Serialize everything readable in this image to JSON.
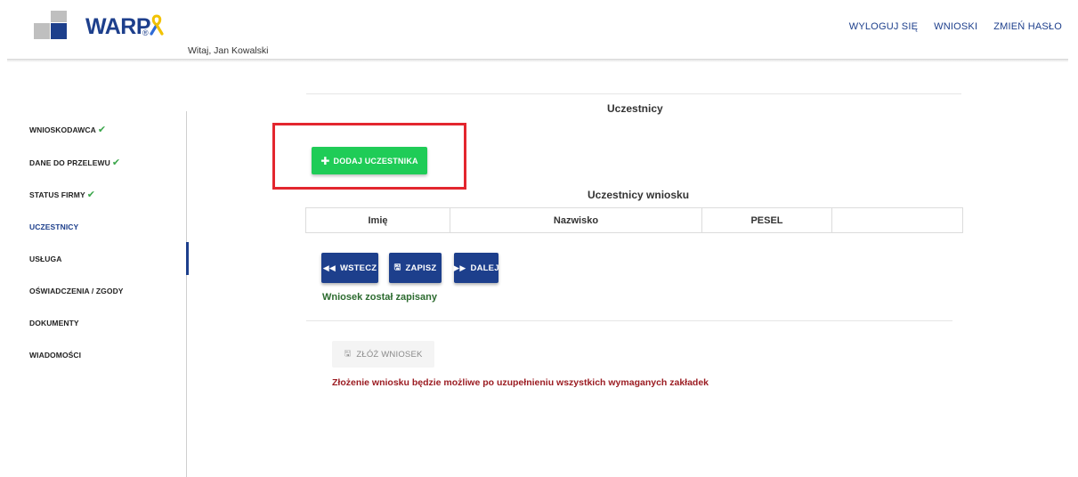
{
  "brand": {
    "name": "WARP",
    "reg": "®",
    "primary": "#1d3f8c",
    "success": "#1fcc57",
    "danger": "#9b1c22"
  },
  "header": {
    "welcome": "Witaj, Jan Kowalski",
    "nav": {
      "logout": "WYLOGUJ SIĘ",
      "applications": "WNIOSKI",
      "change_password": "ZMIEŃ HASŁO"
    }
  },
  "sidebar": {
    "items": [
      {
        "label": "WNIOSKODAWCA",
        "done": true
      },
      {
        "label": "DANE DO PRZELEWU",
        "done": true
      },
      {
        "label": "STATUS FIRMY",
        "done": true
      },
      {
        "label": "UCZESTNICY",
        "active": true
      },
      {
        "label": "USŁUGA"
      },
      {
        "label": "OŚWIADCZENIA / ZGODY"
      },
      {
        "label": "DOKUMENTY"
      },
      {
        "label": "WIADOMOŚCI"
      }
    ],
    "check_glyph": "✔"
  },
  "main": {
    "title": "Uczestnicy",
    "add_button": "DODAJ UCZESTNIKA",
    "table_title": "Uczestnicy wniosku",
    "columns": [
      "Imię",
      "Nazwisko",
      "PESEL",
      ""
    ],
    "buttons": {
      "back": "WSTECZ",
      "save": "ZAPISZ",
      "next": "DALEJ"
    },
    "saved_msg": "Wniosek został zapisany",
    "submit_button": "ZŁÓŻ WNIOSEK",
    "submit_warning": "Złożenie wniosku będzie możliwe po uzupełnieniu wszystkich wymaganych zakładek"
  }
}
